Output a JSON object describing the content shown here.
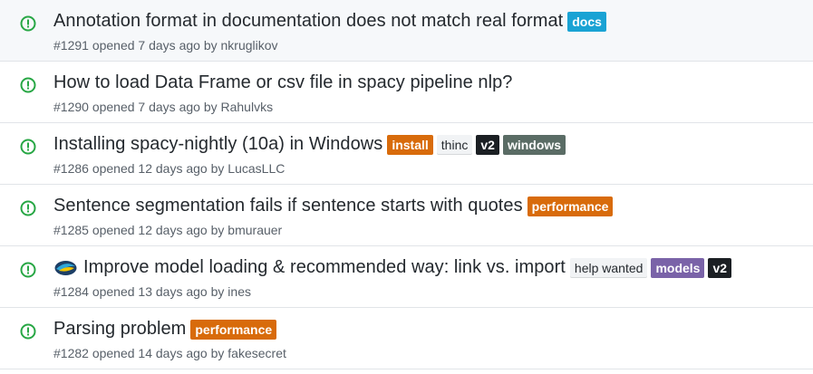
{
  "colors": {
    "open_icon": "#28a745",
    "title_text": "#24292e",
    "meta_text": "#586069",
    "row_highlight": "#f6f8fa",
    "border": "#e1e4e8"
  },
  "issues": [
    {
      "title": "Annotation format in documentation does not match real format",
      "number": "#1291",
      "opened_text": "opened 7 days ago by",
      "author": "nkruglikov",
      "icon": "issue-opened-icon",
      "avatar": false,
      "labels": [
        {
          "text": "docs",
          "bg": "#1aa3d4",
          "fg": "#ffffff",
          "style": "solid"
        }
      ]
    },
    {
      "title": "How to load Data Frame or csv file in spacy pipeline nlp?",
      "number": "#1290",
      "opened_text": "opened 7 days ago by",
      "author": "Rahulvks",
      "icon": "issue-opened-icon",
      "avatar": false,
      "labels": []
    },
    {
      "title": "Installing spacy-nightly (10a) in Windows",
      "number": "#1286",
      "opened_text": "opened 12 days ago by",
      "author": "LucasLLC",
      "icon": "issue-opened-icon",
      "avatar": false,
      "labels": [
        {
          "text": "install",
          "bg": "#d86b0b",
          "fg": "#ffffff",
          "style": "solid"
        },
        {
          "text": "thinc",
          "bg": "#f1f3f5",
          "fg": "#24292e",
          "style": "light"
        },
        {
          "text": "v2",
          "bg": "#1b1f23",
          "fg": "#ffffff",
          "style": "solid"
        },
        {
          "text": "windows",
          "bg": "#5a6c65",
          "fg": "#ffffff",
          "style": "solid"
        }
      ]
    },
    {
      "title": "Sentence segmentation fails if sentence starts with quotes",
      "number": "#1285",
      "opened_text": "opened 12 days ago by",
      "author": "bmurauer",
      "icon": "issue-opened-icon",
      "avatar": false,
      "labels": [
        {
          "text": "performance",
          "bg": "#d86b0b",
          "fg": "#ffffff",
          "style": "solid"
        }
      ]
    },
    {
      "title": "Improve model loading & recommended way: link vs. import",
      "number": "#1284",
      "opened_text": "opened 13 days ago by",
      "author": "ines",
      "icon": "issue-opened-icon",
      "avatar": true,
      "labels": [
        {
          "text": "help wanted",
          "bg": "#f1f3f5",
          "fg": "#24292e",
          "style": "light"
        },
        {
          "text": "models",
          "bg": "#7a63a8",
          "fg": "#ffffff",
          "style": "solid"
        },
        {
          "text": "v2",
          "bg": "#1b1f23",
          "fg": "#ffffff",
          "style": "solid"
        }
      ]
    },
    {
      "title": "Parsing problem",
      "number": "#1282",
      "opened_text": "opened 14 days ago by",
      "author": "fakesecret",
      "icon": "issue-opened-icon",
      "avatar": false,
      "labels": [
        {
          "text": "performance",
          "bg": "#d86b0b",
          "fg": "#ffffff",
          "style": "solid"
        }
      ]
    }
  ]
}
